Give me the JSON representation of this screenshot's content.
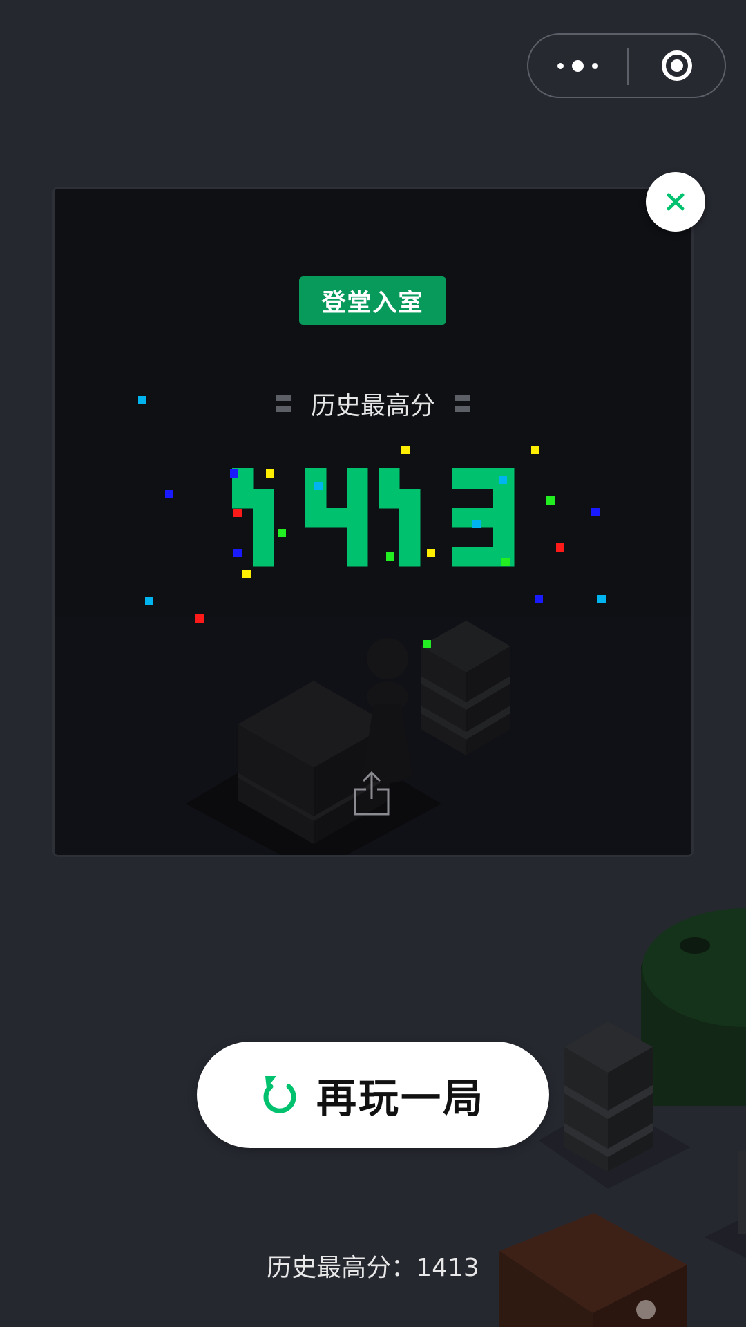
{
  "capsule": {
    "more_icon": "more-dots-icon",
    "exit_icon": "target-circle-icon"
  },
  "panel": {
    "close_icon": "close-x-icon",
    "badge": "登堂入室",
    "highscore_title": "历史最高分",
    "score": "1413",
    "share_icon": "share-upload-icon"
  },
  "replay": {
    "label": "再玩一局",
    "icon": "replay-arrow-icon"
  },
  "footer": {
    "label": "历史最高分：",
    "value": "1413"
  },
  "colors": {
    "accent": "#00c26e",
    "badge": "#079a5b",
    "background": "#262830",
    "panel": "#0f1014",
    "confetti": [
      "#00b4f0",
      "#ffee00",
      "#1a1aff",
      "#ff1a1a",
      "#22ee22"
    ]
  }
}
